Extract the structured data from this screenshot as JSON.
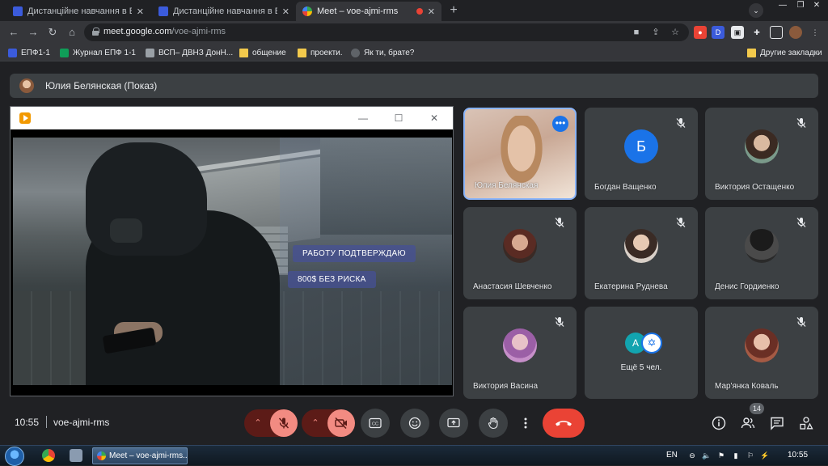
{
  "browser": {
    "tabs": [
      {
        "label": "Дистанційне навчання в ВСП",
        "icon": "classroom-icon"
      },
      {
        "label": "Дистанційне навчання в ВСП",
        "icon": "classroom-icon"
      },
      {
        "label": "Meet – voe-ajmi-rms",
        "icon": "meet-icon",
        "recording": true
      }
    ],
    "url_host": "meet.google.com",
    "url_path": "/voe-ajmi-rms",
    "bookmarks": [
      {
        "label": "ЕПФ1-1",
        "icon": "classroom-icon"
      },
      {
        "label": "Журнал ЕПФ 1-1",
        "icon": "sheets-icon"
      },
      {
        "label": "ВСП– ДВНЗ ДонН...",
        "icon": "image-icon"
      },
      {
        "label": "общение",
        "icon": "folder-icon"
      },
      {
        "label": "проекти.",
        "icon": "folder-icon"
      },
      {
        "label": "Як ти, брате?",
        "icon": "globe-icon"
      }
    ],
    "other_bookmarks": "Другие закладки"
  },
  "meet": {
    "presenter_banner": "Юлия Белянская (Показ)",
    "presentation": {
      "overlay_1": "РАБОТУ ПОДТВЕРЖДАЮ",
      "overlay_2": "800$   БЕЗ РИСКА"
    },
    "participants": [
      {
        "name": "Юлия Белянская",
        "featured": true
      },
      {
        "name": "Богдан Ващенко",
        "initial": "Б",
        "muted": true
      },
      {
        "name": "Виктория Остащенко",
        "muted": true
      },
      {
        "name": "Анастасия Шевченко",
        "muted": true
      },
      {
        "name": "Екатерина Руднева",
        "muted": true
      },
      {
        "name": "Денис Гордиенко",
        "muted": true
      },
      {
        "name": "Виктория Васина",
        "muted": true
      },
      {
        "name": "Ещё 5 чел.",
        "group_initial": "А"
      },
      {
        "name": "Мар'янка Коваль",
        "muted": true
      }
    ],
    "clock": "10:55",
    "meeting_code": "voe-ajmi-rms",
    "participant_count": "14"
  },
  "taskbar": {
    "task_label": "Meet – voe-ajmi-rms...",
    "lang": "EN",
    "time": "10:55"
  },
  "colors": {
    "accent": "#8ab4f8",
    "hangup": "#ea4335",
    "muted_control": "#f28b82"
  }
}
